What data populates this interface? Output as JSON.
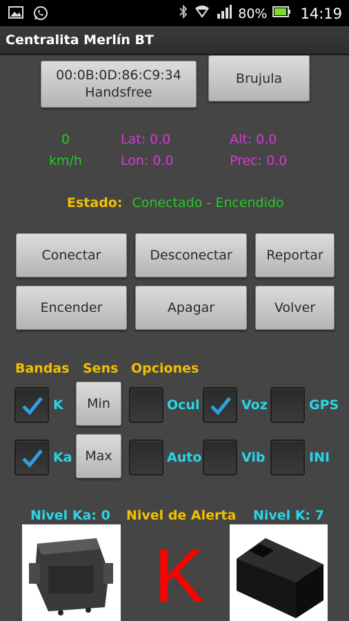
{
  "statusbar": {
    "battery": "80%",
    "time": "14:19"
  },
  "app": {
    "title": "Centralita Merlín BT"
  },
  "device_button": {
    "mac": "00:0B:0D:86:C9:34",
    "name": "Handsfree"
  },
  "compass_button": "Brujula",
  "speed": {
    "value": "0",
    "unit": "km/h"
  },
  "gps": {
    "lat": "Lat: 0.0",
    "lon": "Lon: 0.0",
    "alt": "Alt: 0.0",
    "prec": "Prec: 0.0"
  },
  "status": {
    "label": "Estado:",
    "connection": "Conectado",
    "separator": "-",
    "power": "Encendido"
  },
  "actions": {
    "connect": "Conectar",
    "disconnect": "Desconectar",
    "report": "Reportar",
    "power_on": "Encender",
    "power_off": "Apagar",
    "back": "Volver"
  },
  "sections": {
    "bands": "Bandas",
    "sens": "Sens",
    "options": "Opciones"
  },
  "bands": [
    {
      "label": "K",
      "checked": true
    },
    {
      "label": "Ka",
      "checked": true
    }
  ],
  "sens": {
    "min": "Min",
    "max": "Max"
  },
  "options": [
    {
      "label": "Ocul",
      "checked": false
    },
    {
      "label": "Voz",
      "checked": true
    },
    {
      "label": "GPS",
      "checked": false
    },
    {
      "label": "Auto",
      "checked": false
    },
    {
      "label": "Vib",
      "checked": false
    },
    {
      "label": "INI",
      "checked": false
    }
  ],
  "levels": {
    "ka": "Nivel Ka: 0",
    "alert": "Nivel de Alerta",
    "k": "Nivel K: 7",
    "alert_value": "K"
  },
  "colors": {
    "green": "#22cc22",
    "magenta": "#d63ad6",
    "yellow": "#f2c000",
    "cyan": "#28d6e6",
    "check": "#2f9fe0",
    "alert": "#ff0000"
  }
}
